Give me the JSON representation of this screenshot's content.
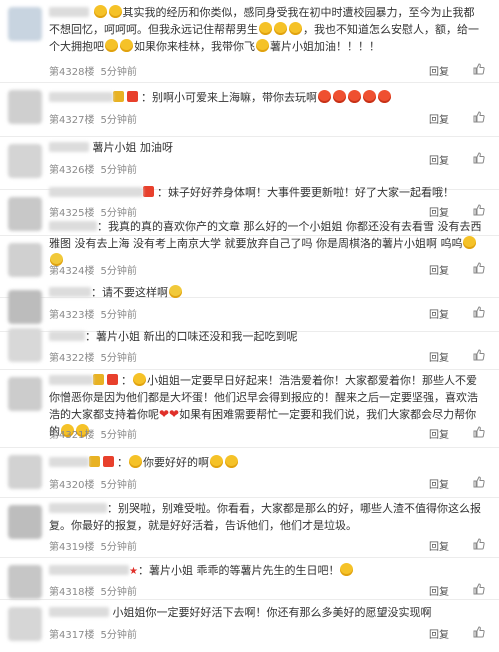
{
  "comments": [
    {
      "pre": "",
      "text": "其实我的经历和你类似，感同身受我在初中时遭校园暴力，至今为止我都不想回忆，呵呵呵。但我永远记住帮帮男生",
      "text2": "如果你来桂林，我带你飞",
      "text3": "薯片小姐加油！！！！",
      "floor": "第4328楼",
      "time": "5分钟前",
      "reply": "回复"
    },
    {
      "pre": "：",
      "text": "别啊小可爱来上海嘛，带你去玩啊",
      "text2": "",
      "text3": "",
      "floor": "第4327楼",
      "time": "5分钟前",
      "reply": "回复"
    },
    {
      "pre": "",
      "text": "薯片小姐 加油呀",
      "text2": "",
      "text3": "",
      "floor": "第4326楼",
      "time": "5分钟前",
      "reply": "回复"
    },
    {
      "pre": "",
      "text": "妹子好好养身体啊！大事件要更新啦！好了大家一起看哦！",
      "text2": "",
      "text3": "",
      "floor": "第4325楼",
      "time": "5分钟前",
      "reply": "回复"
    },
    {
      "pre": "：",
      "text": "我真的真的喜欢你产的文章 那么好的一个小姐姐 你都还没有去看雪 没有去西雅图 没有去上海 没有考上南京大学 就要放弃自己了吗 你是周棋洛的薯片小姐啊 呜呜",
      "text2": "",
      "text3": "",
      "floor": "第4324楼",
      "time": "5分钟前",
      "reply": "回复"
    },
    {
      "pre": "：",
      "text": "请不要这样啊",
      "text2": "",
      "text3": "",
      "floor": "第4323楼",
      "time": "5分钟前",
      "reply": "回复"
    },
    {
      "pre": "：",
      "text": "薯片小姐 新出的口味还没和我一起吃到呢",
      "text2": "",
      "text3": "",
      "floor": "第4322楼",
      "time": "5分钟前",
      "reply": "回复"
    },
    {
      "pre": "：",
      "text": "小姐姐一定要早日好起来！浩浩爱着你！大家都爱着你！那些人不爱你憎恶你是因为他们都是大坏蛋！他们迟早会得到报应的！醒来之后一定要坚强，喜欢浩浩的大家都支持着你呢",
      "text2": "如果有困难需要帮忙一定要和我们说，我们大家都会尽力帮你的",
      "text3": "",
      "floor": "第4321楼",
      "time": "5分钟前",
      "reply": "回复"
    },
    {
      "pre": "：",
      "text": "你要好好的啊",
      "text2": "",
      "text3": "",
      "floor": "第4320楼",
      "time": "5分钟前",
      "reply": "回复"
    },
    {
      "pre": "：",
      "text": "别哭啦，别难受啦。你看看，大家都是那么的好，哪些人渣不值得你这么报复。你最好的报复，就是好好活着，告诉他们，他们才是垃圾。",
      "text2": "",
      "text3": "",
      "floor": "第4319楼",
      "time": "5分钟前",
      "reply": "回复"
    },
    {
      "pre": "：",
      "text": "薯片小姐 乖乖的等薯片先生的生日吧！",
      "text2": "",
      "text3": "",
      "floor": "第4318楼",
      "time": "5分钟前",
      "reply": "回复"
    },
    {
      "pre": "",
      "text": "小姐姐你一定要好好活下去啊！你还有那么多美好的愿望没实现啊",
      "text2": "",
      "text3": "",
      "floor": "第4317楼",
      "time": "5分钟前",
      "reply": "回复"
    }
  ]
}
